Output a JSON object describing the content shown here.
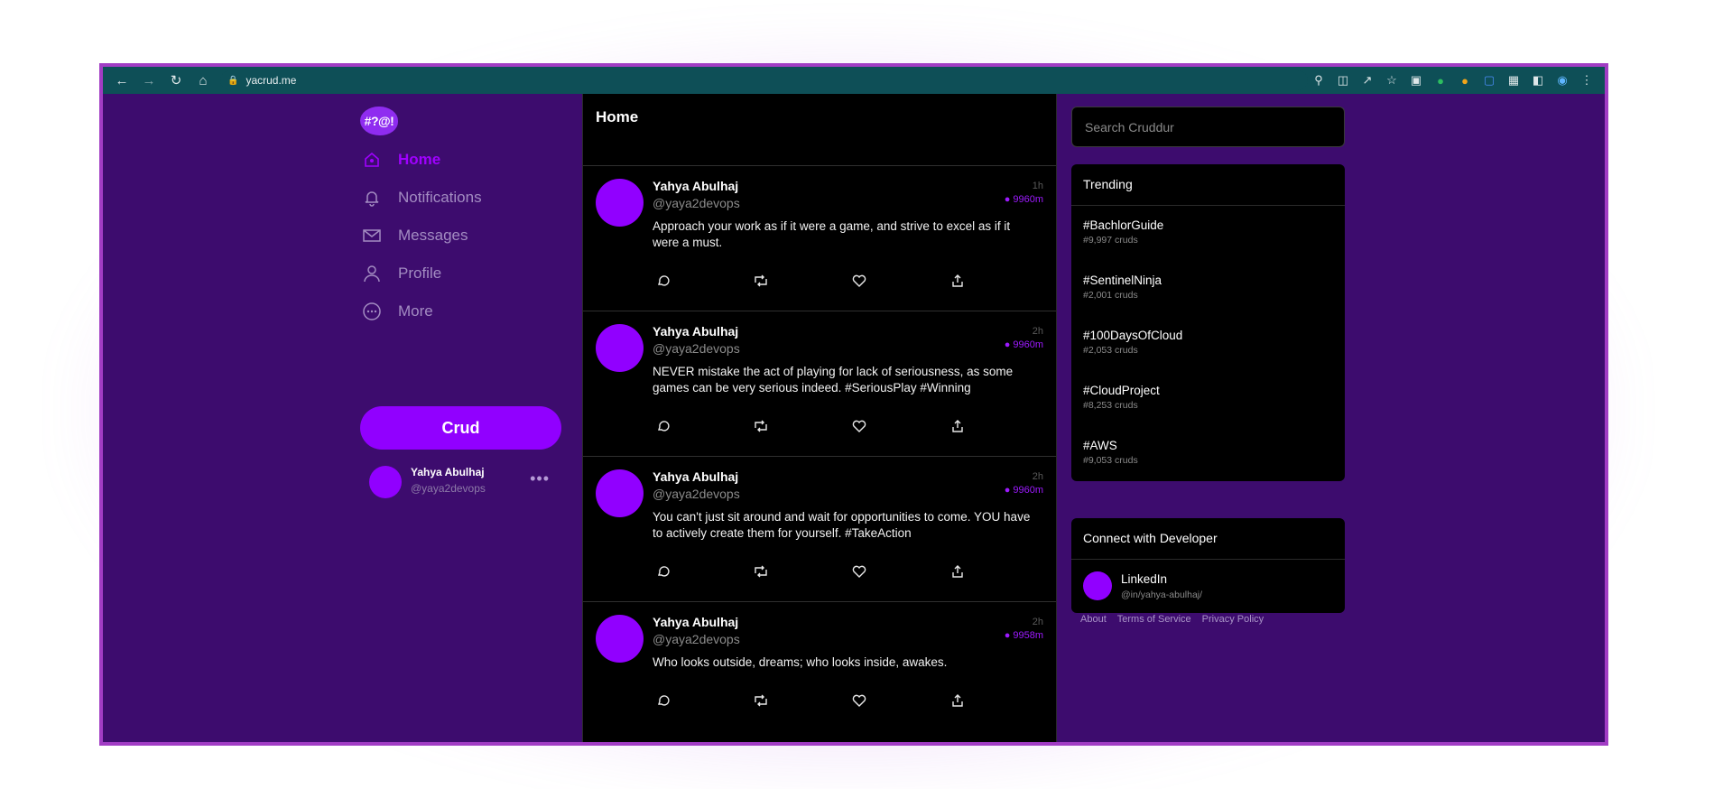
{
  "browser": {
    "url": "yacrud.me"
  },
  "sidebar": {
    "logo": "#?@!",
    "items": [
      {
        "label": "Home",
        "icon": "home-icon"
      },
      {
        "label": "Notifications",
        "icon": "bell-icon"
      },
      {
        "label": "Messages",
        "icon": "mail-icon"
      },
      {
        "label": "Profile",
        "icon": "user-icon"
      },
      {
        "label": "More",
        "icon": "more-circle-icon"
      }
    ],
    "crud_button": "Crud",
    "user": {
      "name": "Yahya Abulhaj",
      "handle": "@yaya2devops"
    }
  },
  "feed": {
    "title": "Home",
    "posts": [
      {
        "name": "Yahya Abulhaj",
        "handle": "@yaya2devops",
        "time": "1h",
        "distance": "9960m",
        "text": "Approach your work as if it were a game, and strive to excel as if it were a must."
      },
      {
        "name": "Yahya Abulhaj",
        "handle": "@yaya2devops",
        "time": "2h",
        "distance": "9960m",
        "text": "NEVER mistake the act of playing for lack of seriousness, as some games can be very serious indeed. #SeriousPlay #Winning"
      },
      {
        "name": "Yahya Abulhaj",
        "handle": "@yaya2devops",
        "time": "2h",
        "distance": "9960m",
        "text": "You can't just sit around and wait for opportunities to come. YOU have to actively create them for yourself. #TakeAction"
      },
      {
        "name": "Yahya Abulhaj",
        "handle": "@yaya2devops",
        "time": "2h",
        "distance": "9958m",
        "text": "Who looks outside, dreams; who looks inside, awakes."
      }
    ]
  },
  "search": {
    "placeholder": "Search Cruddur"
  },
  "trending": {
    "title": "Trending",
    "items": [
      {
        "tag": "#BachlorGuide",
        "count": "#9,997 cruds"
      },
      {
        "tag": "#SentinelNinja",
        "count": "#2,001 cruds"
      },
      {
        "tag": "#100DaysOfCloud",
        "count": "#2,053 cruds"
      },
      {
        "tag": "#CloudProject",
        "count": "#8,253 cruds"
      },
      {
        "tag": "#AWS",
        "count": "#9,053 cruds"
      }
    ]
  },
  "connect": {
    "title": "Connect with Developer",
    "name": "LinkedIn",
    "handle": "@in/yahya-abulhaj/"
  },
  "footer": {
    "about": "About",
    "terms": "Terms of Service",
    "privacy": "Privacy Policy"
  },
  "colors": {
    "accent": "#9100ff",
    "app_bg": "#3d0c6e",
    "chrome_bg": "#0e4f57",
    "frame": "#a13cc4"
  }
}
